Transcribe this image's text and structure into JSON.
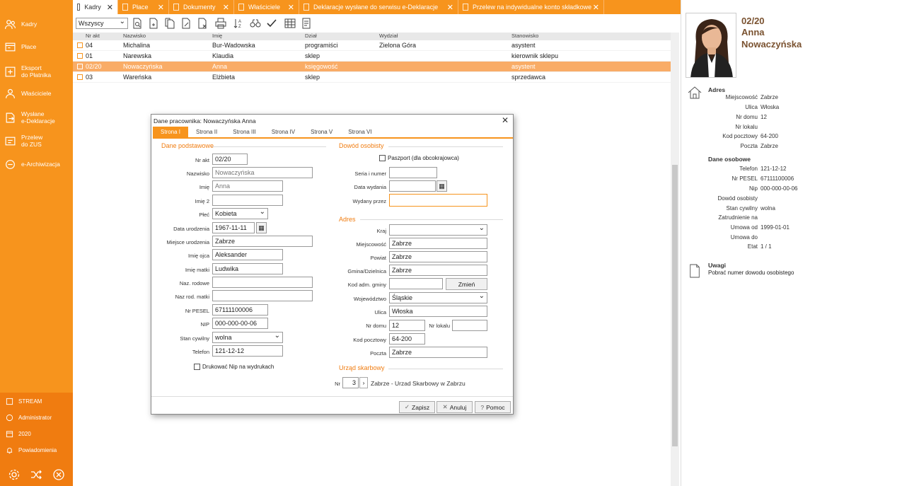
{
  "sidebar": {
    "items": [
      {
        "label": "Kadry",
        "icon": "people-icon"
      },
      {
        "label": "Płace",
        "icon": "payroll-icon"
      },
      {
        "label": "Eksport\ndo Płatnika",
        "icon": "export-icon"
      },
      {
        "label": "Właściciele",
        "icon": "owners-icon"
      },
      {
        "label": "Wysłane\ne-Deklaracje",
        "icon": "sent-icon"
      },
      {
        "label": "Przelew\ndo ZUS",
        "icon": "transfer-icon"
      },
      {
        "label": "e-Archiwizacja",
        "icon": "archive-icon"
      }
    ],
    "bottom": [
      {
        "label": "STREAM",
        "icon": "company-icon"
      },
      {
        "label": "Administrator",
        "icon": "user-icon"
      },
      {
        "label": "2020",
        "icon": "calendar-icon"
      },
      {
        "label": "Powiadomienia",
        "icon": "bell-icon"
      }
    ]
  },
  "tabs": [
    {
      "label": "Kadry",
      "active": true
    },
    {
      "label": "Płace"
    },
    {
      "label": "Dokumenty"
    },
    {
      "label": "Właściciele"
    },
    {
      "label": "Deklaracje wysłane do serwisu e-Deklaracje"
    },
    {
      "label": "Przelew na indywidualne konto składkowe"
    }
  ],
  "toolbar": {
    "filter_value": "Wszyscy"
  },
  "grid": {
    "columns": [
      "Nr akt",
      "Nazwisko",
      "Imię",
      "Dział",
      "Wydział",
      "Stanowisko"
    ],
    "rows": [
      [
        "04",
        "Michalina",
        "Bur-Wadowska",
        "programiści",
        "Zielona Góra",
        "asystent"
      ],
      [
        "01",
        "Narewska",
        "Klaudia",
        "sklep",
        "",
        "kierownik sklepu"
      ],
      [
        "02/20",
        "Nowaczyńska",
        "Anna",
        "księgowość",
        "",
        "asystent"
      ],
      [
        "03",
        "Wareńska",
        "Elżbieta",
        "sklep",
        "",
        "sprzedawca"
      ]
    ],
    "selected_row": 2
  },
  "rpanel": {
    "nr": "02/20",
    "first_name": "Anna",
    "last_name": "Nowaczyńska",
    "adres_title": "Adres",
    "adres": [
      {
        "k": "Miejscowość",
        "v": "Zabrze"
      },
      {
        "k": "Ulica",
        "v": "Włoska"
      },
      {
        "k": "Nr domu",
        "v": "12"
      },
      {
        "k": "Nr lokalu",
        "v": ""
      },
      {
        "k": "Kod pocztowy",
        "v": "64-200"
      },
      {
        "k": "Poczta",
        "v": "Zabrze"
      }
    ],
    "osobowe_title": "Dane osobowe",
    "osobowe": [
      {
        "k": "Telefon",
        "v": "121-12-12"
      },
      {
        "k": "Nr PESEL",
        "v": "67111100006"
      },
      {
        "k": "Nip",
        "v": "000-000-00-06"
      },
      {
        "k": "Dowód osobisty",
        "v": ""
      },
      {
        "k": "Stan cywilny",
        "v": "wolna"
      },
      {
        "k": "Zatrudnienie na",
        "v": ""
      },
      {
        "k": "Umowa od",
        "v": "1999-01-01"
      },
      {
        "k": "Umowa do",
        "v": ""
      },
      {
        "k": "Etat",
        "v": "1 / 1"
      }
    ],
    "uwagi_title": "Uwagi",
    "uwagi_text": "Pobrać numer dowodu osobistego"
  },
  "dialog": {
    "title": "Dane pracownika: Nowaczyńska Anna",
    "tabs": [
      "Strona I",
      "Strona II",
      "Strona III",
      "Strona IV",
      "Strona V",
      "Strona VI"
    ],
    "group_basic": "Dane podstawowe",
    "group_id": "Dowód osobisty",
    "group_addr": "Adres",
    "group_tax": "Urząd skarbowy",
    "labels": {
      "nr_akt": "Nr akt",
      "nazwisko": "Nazwisko",
      "imie": "Imię",
      "imie2": "Imię 2",
      "plec": "Płeć",
      "data_ur": "Data urodzenia",
      "miejsce_ur": "Miejsce urodzenia",
      "imie_ojca": "Imię ojca",
      "imie_matki": "Imię matki",
      "naz_rodowe": "Naz. rodowe",
      "naz_rod_matki": "Naz rod. matki",
      "pesel": "Nr PESEL",
      "nip": "NIP",
      "stan_cywilny": "Stan cywilny",
      "telefon": "Telefon",
      "paszport": "Paszport (dla obcokrajowca)",
      "seria": "Seria i numer",
      "data_wydania": "Data wydania",
      "wydany_przez": "Wydany przez",
      "kraj": "Kraj",
      "miejscowosc": "Miejscowość",
      "powiat": "Powiat",
      "gmina": "Gmina/Dzielnica",
      "kod_adm": "Kod adm. gminy",
      "wojewodztwo": "Województwo",
      "ulica": "Ulica",
      "nr_domu": "Nr domu",
      "nr_lokalu": "Nr lokalu",
      "kod_pocztowy": "Kod pocztowy",
      "poczta": "Poczta",
      "us_nr": "Nr",
      "drukowac_nip": "Drukować Nip na wydrukach"
    },
    "values": {
      "nr_akt": "02/20",
      "nazwisko": "Nowaczyńska",
      "imie": "Anna",
      "imie2": "",
      "plec": "Kobieta",
      "data_ur": "1967-11-11",
      "miejsce_ur": "Zabrze",
      "imie_ojca": "Aleksander",
      "imie_matki": "Ludwika",
      "naz_rodowe": "",
      "naz_rod_matki": "",
      "pesel": "67111100006",
      "nip": "000-000-00-06",
      "stan_cywilny": "wolna",
      "telefon": "121-12-12",
      "seria": "",
      "data_wydania": "",
      "wydany_przez": "",
      "kraj": "",
      "miejscowosc": "Zabrze",
      "powiat": "Zabrze",
      "gmina": "Zabrze",
      "kod_adm": "",
      "wojewodztwo": "Śląskie",
      "ulica": "Włoska",
      "nr_domu": "12",
      "nr_lokalu": "",
      "kod_pocztowy": "64-200",
      "poczta": "Zabrze",
      "us_nr": "3",
      "us_name": "Zabrze - Urzad Skarbowy w Zabrzu"
    },
    "buttons": {
      "zmien": "Zmień",
      "zapisz": "Zapisz",
      "anuluj": "Anuluj",
      "pomoc": "Pomoc"
    }
  }
}
